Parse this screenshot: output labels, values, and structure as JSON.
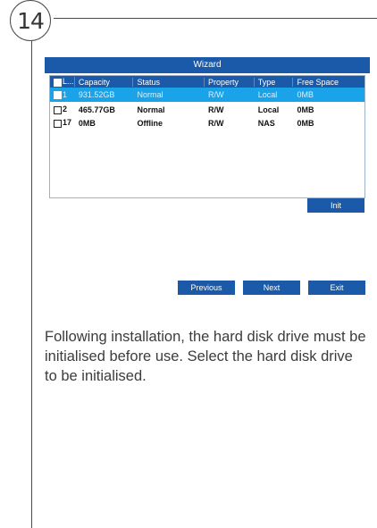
{
  "step": {
    "number": "14"
  },
  "wizard": {
    "title": "Wizard",
    "columns": [
      "L...",
      "Capacity",
      "Status",
      "Property",
      "Type",
      "Free Space"
    ],
    "rows": [
      {
        "id": "1",
        "capacity": "931.52GB",
        "status": "Normal",
        "property": "R/W",
        "type": "Local",
        "free_space": "0MB",
        "selected": true
      },
      {
        "id": "2",
        "capacity": "465.77GB",
        "status": "Normal",
        "property": "R/W",
        "type": "Local",
        "free_space": "0MB",
        "selected": false
      },
      {
        "id": "17",
        "capacity": "0MB",
        "status": "Offline",
        "property": "R/W",
        "type": "NAS",
        "free_space": "0MB",
        "selected": false
      }
    ],
    "buttons": {
      "init": "Init",
      "previous": "Previous",
      "next": "Next",
      "exit": "Exit"
    }
  },
  "instruction": "Following installation, the hard disk drive must be initialised before use. Select the hard disk drive to be initialised.",
  "colors": {
    "titlebar": "#1b5aa8",
    "selected_row": "#1aa3e8",
    "line": "#4a4a4a"
  }
}
